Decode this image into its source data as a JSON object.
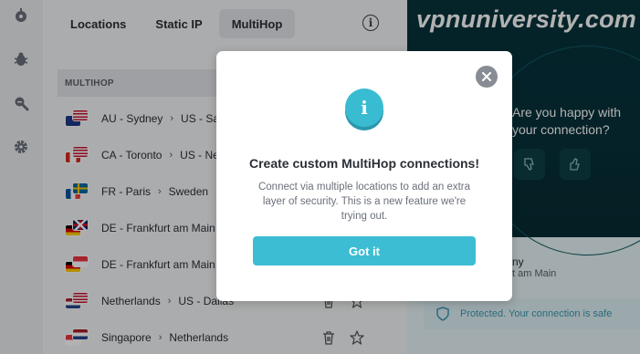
{
  "tabs": [
    "Locations",
    "Static IP",
    "MultiHop"
  ],
  "active_tab": "MultiHop",
  "section_header": "MULTIHOP",
  "routes": [
    {
      "from": "AU - Sydney",
      "to": "US - San Jose",
      "flags": [
        "us",
        "au"
      ],
      "show_actions": false
    },
    {
      "from": "CA - Toronto",
      "to": "US - New York",
      "flags": [
        "us",
        "ca"
      ],
      "show_actions": false
    },
    {
      "from": "FR - Paris",
      "to": "Sweden",
      "flags": [
        "se",
        "fr"
      ],
      "show_actions": false
    },
    {
      "from": "DE - Frankfurt am Main",
      "to": "",
      "flags": [
        "uk",
        "de"
      ],
      "show_actions": false
    },
    {
      "from": "DE - Frankfurt am Main",
      "to": "",
      "flags": [
        "sg",
        "de"
      ],
      "show_actions": false
    },
    {
      "from": "Netherlands",
      "to": "US - Dallas",
      "flags": [
        "us",
        "nl"
      ],
      "show_actions": true
    },
    {
      "from": "Singapore",
      "to": "Netherlands",
      "flags": [
        "nl",
        "sg"
      ],
      "show_actions": true
    }
  ],
  "right_panel": {
    "watermark": "vpnuniversity.com",
    "feedback_line1": "Are you happy with",
    "feedback_line2": "your connection?",
    "server_name": "ny",
    "server_location": "t am Main",
    "status_text": "Protected. Your connection is safe"
  },
  "modal": {
    "title": "Create custom MultiHop connections!",
    "body": "Connect via multiple locations to add an extra layer of security. This is a new feature we're trying out.",
    "button_label": "Got it"
  },
  "colors": {
    "accent": "#3cbdd3",
    "hero_bg": "#07333b",
    "overlay": "rgba(0,0,0,0.30)"
  },
  "icons": {
    "rail": [
      "vpn-status-icon",
      "bug-icon",
      "search-ip-icon",
      "gear-icon"
    ],
    "row_actions": [
      "trash-icon",
      "star-icon"
    ]
  }
}
